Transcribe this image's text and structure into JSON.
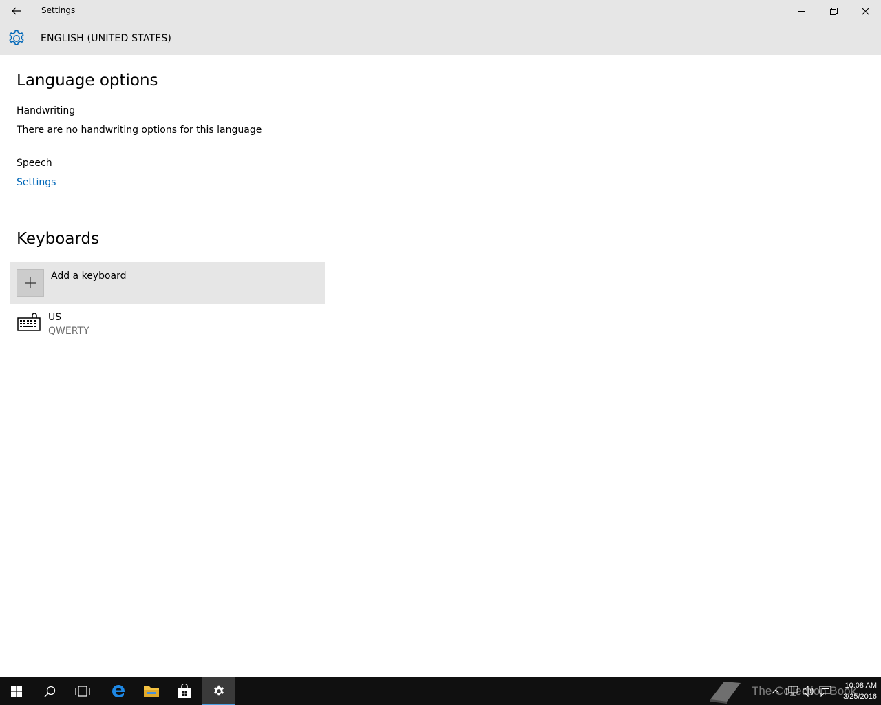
{
  "window": {
    "title": "Settings"
  },
  "header": {
    "title": "ENGLISH (UNITED STATES)",
    "icon": "gear-icon"
  },
  "language_options": {
    "heading": "Language options",
    "handwriting": {
      "label": "Handwriting",
      "message": "There are no handwriting options for this language"
    },
    "speech": {
      "label": "Speech",
      "settings_link": "Settings"
    }
  },
  "keyboards": {
    "heading": "Keyboards",
    "add_label": "Add a keyboard",
    "items": [
      {
        "name": "US",
        "layout": "QWERTY",
        "icon": "keyboard-icon"
      }
    ]
  },
  "taskbar": {
    "pinned": [
      {
        "name": "start",
        "icon": "windows-logo-icon"
      },
      {
        "name": "search",
        "icon": "search-icon"
      },
      {
        "name": "task-view",
        "icon": "task-view-icon"
      },
      {
        "name": "edge",
        "icon": "edge-icon"
      },
      {
        "name": "file-explorer",
        "icon": "folder-icon"
      },
      {
        "name": "store",
        "icon": "store-icon"
      },
      {
        "name": "settings",
        "icon": "gear-icon",
        "active": true
      }
    ],
    "watermark": "The Collection Book",
    "tray": [
      "chevron-up-icon",
      "network-icon",
      "volume-icon",
      "action-center-icon"
    ],
    "clock": {
      "time": "10:08 AM",
      "date": "3/25/2016"
    }
  },
  "colors": {
    "chrome": "#e6e6e6",
    "accent": "#0067b8",
    "secondary_text": "#6b6b6b",
    "taskbar": "#101010"
  }
}
